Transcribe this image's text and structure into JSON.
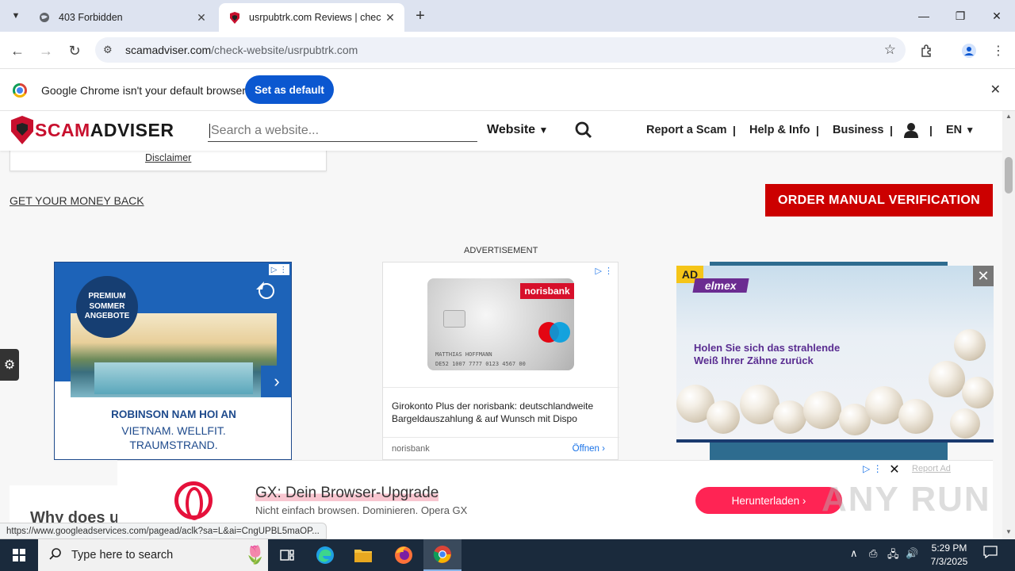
{
  "browser": {
    "tabs": [
      {
        "title": "403 Forbidden",
        "close": "✕"
      },
      {
        "title": "usrpubtrk.com Reviews | check",
        "close": "✕"
      }
    ],
    "new_tab": "+",
    "window_controls": {
      "minimize": "—",
      "restore": "❐",
      "close": "✕"
    },
    "url_host": "scamadviser.com",
    "url_path": "/check-website/usrpubtrk.com",
    "infobar": {
      "message": "Google Chrome isn't your default browser",
      "button": "Set as default"
    },
    "status_url": "https://www.googleadservices.com/pagead/aclk?sa=L&ai=CngUPBL5maOP..."
  },
  "site": {
    "logo_scam": "SCAM",
    "logo_adviser": "ADVISER",
    "search_placeholder": "Search a website...",
    "search_type": "Website",
    "nav": [
      "Report a Scam",
      "Help & Info",
      "Business"
    ],
    "nav_sep": "|",
    "language": "EN",
    "disclaimer": "Disclaimer",
    "money_back": "GET YOUR MONEY BACK",
    "order_verification": "ORDER MANUAL VERIFICATION",
    "advertisement_label": "ADVERTISEMENT",
    "why_heading": "Why does us"
  },
  "ads": {
    "robinson": {
      "badge": [
        "PREMIUM",
        "SOMMER",
        "ANGEBOTE"
      ],
      "headline": "ROBINSON NAM HOI AN",
      "line2": "VIETNAM. WELLFIT.",
      "line3": "TRAUMSTRAND.",
      "next": "›"
    },
    "norisbank": {
      "brand": "norisbank",
      "card_name": "MATTHIAS HOFFMANN",
      "card_number": "DE52 1007 7777 0123 4567 00",
      "copy": "Girokonto Plus der norisbank: deutschlandweite Bargeldauszahlung & auf Wunsch mit Dispo",
      "advertiser": "norisbank",
      "open": "Öffnen"
    },
    "elmex": {
      "tag": "AD",
      "brand": "elmex",
      "headline1": "Holen Sie sich das strahlende",
      "headline2": "Weiß Ihrer Zähne zurück",
      "close": "✕"
    },
    "opera": {
      "title": "GX: Dein Browser-Upgrade",
      "subtitle": "Nicht einfach browsen. Dominieren. Opera GX",
      "button": "Herunterladen ›",
      "close": "✕",
      "report": "Report Ad"
    }
  },
  "watermark": "ANY RUN",
  "taskbar": {
    "search_placeholder": "Type here to search",
    "time": "5:29 PM",
    "date": "7/3/2025"
  }
}
